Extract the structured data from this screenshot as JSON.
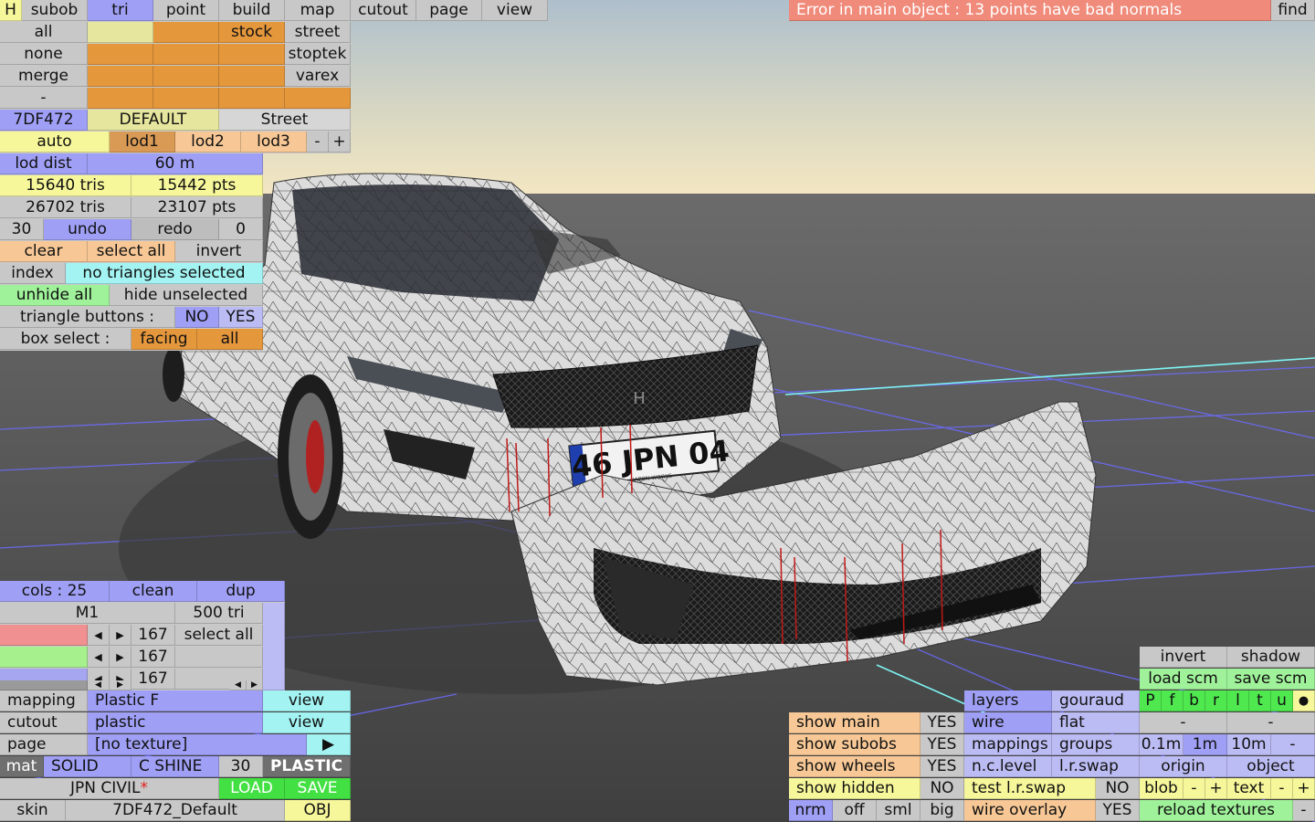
{
  "app": {
    "error_text": "Error in main object : 13 points have bad normals",
    "find": "find"
  },
  "top_tabs": [
    "H",
    "subob",
    "tri",
    "point",
    "build",
    "map",
    "cutout",
    "page",
    "view"
  ],
  "rows": {
    "all": "all",
    "none": "none",
    "merge": "merge",
    "dash": "-",
    "stock": "stock",
    "street": "street",
    "stoptek": "stoptek",
    "varex": "varex",
    "code": "7DF472",
    "default": "DEFAULT",
    "street2": "Street",
    "auto": "auto",
    "lod1": "lod1",
    "lod2": "lod2",
    "lod3": "lod3",
    "minus": "-",
    "plus": "+",
    "lod_dist": "lod dist",
    "lod_val": "60 m",
    "tris1": "15640 tris",
    "pts1": "15442 pts",
    "tris2": "26702 tris",
    "pts2": "23107 pts",
    "n30": "30",
    "undo": "undo",
    "redo": "redo",
    "n0": "0",
    "clear": "clear",
    "select_all": "select all",
    "invert": "invert",
    "index": "index",
    "no_tri": "no triangles selected",
    "unhide": "unhide all",
    "hide_unsel": "hide unselected",
    "tri_buttons": "triangle buttons :",
    "no": "NO",
    "yes": "YES",
    "box_select": "box select :",
    "facing": "facing",
    "all2": "all"
  },
  "cols": {
    "cols": "cols : 25",
    "clean": "clean",
    "dup": "dup",
    "m1": "M1",
    "tri500": "500 tri",
    "c1": "167",
    "c2": "167",
    "c3": "167",
    "select_all": "select all"
  },
  "mat": {
    "mapping": "mapping",
    "plastic_f": "Plastic F",
    "view": "view",
    "cutout": "cutout",
    "plastic": "plastic",
    "view2": "view",
    "page": "page",
    "no_texture": "[no texture]",
    "arrow": "▶",
    "mat": "mat",
    "solid": "SOLID",
    "cshine": "C SHINE",
    "n30": "30",
    "plastic_u": "PLASTIC",
    "jpn": "JPN CIVIL",
    "star": "*",
    "load": "LOAD",
    "save": "SAVE",
    "skin": "skin",
    "skin_val": "7DF472_Default",
    "obj": "OBJ"
  },
  "bottom_right": {
    "invert": "invert",
    "shadow": "shadow",
    "load_scm": "load scm",
    "save_scm": "save scm",
    "letters": [
      "P",
      "f",
      "b",
      "r",
      "l",
      "t",
      "u",
      "●"
    ],
    "layers": "layers",
    "gouraud": "gouraud",
    "show_main": "show main",
    "yes1": "YES",
    "wire": "wire",
    "flat": "flat",
    "dash1": "-",
    "dash2": "-",
    "show_subobs": "show subobs",
    "yes2": "YES",
    "mappings": "mappings",
    "groups": "groups",
    "d01": "0.1m",
    "d1": "1m",
    "d10": "10m",
    "dmin": "-",
    "show_wheels": "show wheels",
    "yes3": "YES",
    "nc_level": "n.c.level",
    "lr_swap": "l.r.swap",
    "origin": "origin",
    "object": "object",
    "show_hidden": "show hidden",
    "no1": "NO",
    "test_lr": "test l.r.swap",
    "no2": "NO",
    "blob": "blob",
    "m": "-",
    "p": "+",
    "text": "text",
    "m2": "-",
    "p2": "+",
    "nrm": "nrm",
    "off": "off",
    "sml": "sml",
    "big": "big",
    "wire_overlay": "wire overlay",
    "yes4": "YES",
    "reload": "reload textures",
    "m3": "-"
  },
  "plate": {
    "text": "46 JPN 04",
    "small": "JAPON WORKS"
  }
}
